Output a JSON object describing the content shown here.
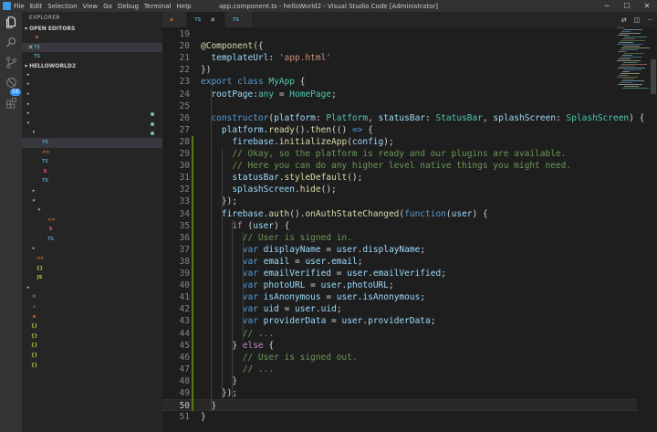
{
  "titlebar": {
    "menu": [
      "File",
      "Edit",
      "Selection",
      "View",
      "Go",
      "Debug",
      "Terminal",
      "Help"
    ],
    "title": "app.component.ts - helloWorld2 - Visual Studio Code [Administrator]"
  },
  "activity": {
    "badge": "58"
  },
  "sidebar": {
    "explorer_title": "EXPLORER",
    "open_editors_title": "OPEN EDITORS",
    "open_editors": [
      {
        "name": "config.xml",
        "dir": "",
        "status": "U",
        "kind": "xml"
      },
      {
        "name": "app.component.ts",
        "dir": "src\\app",
        "status": "M",
        "kind": "ts"
      },
      {
        "name": "app.module.ts",
        "dir": "src\\app",
        "status": "",
        "kind": "ts"
      }
    ],
    "project_title": "HELLOWORLD2",
    "tree": [
      {
        "name": ".sourcemaps",
        "depth": 1,
        "arrow": "▸",
        "kind": "folder",
        "status": "",
        "dot": false
      },
      {
        "name": "node_modules",
        "depth": 1,
        "arrow": "▸",
        "kind": "folder",
        "status": "",
        "dot": false
      },
      {
        "name": "platforms",
        "depth": 1,
        "arrow": "▸",
        "kind": "folder",
        "status": "",
        "dot": false
      },
      {
        "name": "plugins",
        "depth": 1,
        "arrow": "▸",
        "kind": "folder",
        "status": "",
        "dot": false
      },
      {
        "name": "resources",
        "depth": 1,
        "arrow": "▸",
        "kind": "folder-new",
        "status": "",
        "dot": true
      },
      {
        "name": "src",
        "depth": 1,
        "arrow": "▾",
        "kind": "folder",
        "status": "",
        "dot": true
      },
      {
        "name": "app",
        "depth": 2,
        "arrow": "▾",
        "kind": "folder",
        "status": "",
        "dot": true
      },
      {
        "name": "app.component.ts",
        "depth": 3,
        "arrow": "",
        "kind": "ts",
        "status": "M",
        "dot": false
      },
      {
        "name": "app.html",
        "depth": 3,
        "arrow": "",
        "kind": "html",
        "status": "",
        "dot": false
      },
      {
        "name": "app.module.ts",
        "depth": 3,
        "arrow": "",
        "kind": "ts",
        "status": "",
        "dot": false
      },
      {
        "name": "app.scss",
        "depth": 3,
        "arrow": "",
        "kind": "scss",
        "status": "",
        "dot": false
      },
      {
        "name": "main.ts",
        "depth": 3,
        "arrow": "",
        "kind": "ts",
        "status": "",
        "dot": false
      },
      {
        "name": "assets",
        "depth": 2,
        "arrow": "▸",
        "kind": "folder",
        "status": "",
        "dot": false
      },
      {
        "name": "pages",
        "depth": 2,
        "arrow": "▾",
        "kind": "folder",
        "status": "",
        "dot": false
      },
      {
        "name": "home",
        "depth": 3,
        "arrow": "▾",
        "kind": "folder",
        "status": "",
        "dot": false
      },
      {
        "name": "home.html",
        "depth": 4,
        "arrow": "",
        "kind": "html",
        "status": "",
        "dot": false
      },
      {
        "name": "home.scss",
        "depth": 4,
        "arrow": "",
        "kind": "scss",
        "status": "",
        "dot": false
      },
      {
        "name": "home.ts",
        "depth": 4,
        "arrow": "",
        "kind": "ts",
        "status": "",
        "dot": false
      },
      {
        "name": "theme",
        "depth": 2,
        "arrow": "▸",
        "kind": "folder",
        "status": "",
        "dot": false
      },
      {
        "name": "index.html",
        "depth": 2,
        "arrow": "",
        "kind": "html",
        "status": "",
        "dot": false
      },
      {
        "name": "manifest.json",
        "depth": 2,
        "arrow": "",
        "kind": "json",
        "status": "",
        "dot": false
      },
      {
        "name": "service-worker.js",
        "depth": 2,
        "arrow": "",
        "kind": "js",
        "status": "",
        "dot": false
      },
      {
        "name": "www",
        "depth": 1,
        "arrow": "▸",
        "kind": "folder",
        "status": "",
        "dot": false
      },
      {
        "name": ".editorconfig",
        "depth": 1,
        "arrow": "",
        "kind": "cfg",
        "status": "",
        "dot": false
      },
      {
        "name": ".gitignore",
        "depth": 1,
        "arrow": "",
        "kind": "git",
        "status": "",
        "dot": false
      },
      {
        "name": "config.xml",
        "depth": 1,
        "arrow": "",
        "kind": "xml",
        "status": "U",
        "dot": false
      },
      {
        "name": "ionic.config.json",
        "depth": 1,
        "arrow": "",
        "kind": "json",
        "status": "",
        "dot": false
      },
      {
        "name": "package-lock.json",
        "depth": 1,
        "arrow": "",
        "kind": "json",
        "status": "M",
        "dot": false
      },
      {
        "name": "package.json",
        "depth": 1,
        "arrow": "",
        "kind": "json",
        "status": "M",
        "dot": false
      },
      {
        "name": "tsconfig.json",
        "depth": 1,
        "arrow": "",
        "kind": "json",
        "status": "",
        "dot": false
      },
      {
        "name": "tslint.json",
        "depth": 1,
        "arrow": "",
        "kind": "json",
        "status": "",
        "dot": false
      }
    ]
  },
  "tabs": [
    {
      "label": "config.xml",
      "kind": "xml",
      "active": false,
      "italic": false
    },
    {
      "label": "app.component.ts",
      "kind": "ts",
      "active": true,
      "italic": false
    },
    {
      "label": "app.module.ts",
      "kind": "ts",
      "active": false,
      "italic": true
    }
  ],
  "editor": {
    "first_line": 19,
    "current_line": 50,
    "lines": [
      [],
      [
        [
          "t-fn",
          "@Component"
        ],
        [
          "t-p",
          "({"
        ]
      ],
      [
        [
          "t-p",
          "  "
        ],
        [
          "t-var",
          "templateUrl"
        ],
        [
          "t-p",
          ": "
        ],
        [
          "t-str",
          "'app.html'"
        ]
      ],
      [
        [
          "t-p",
          "})"
        ]
      ],
      [
        [
          "t-kw",
          "export"
        ],
        [
          "t-p",
          " "
        ],
        [
          "t-kw",
          "class"
        ],
        [
          "t-p",
          " "
        ],
        [
          "t-type",
          "MyApp"
        ],
        [
          "t-p",
          " {"
        ]
      ],
      [
        [
          "t-p",
          "  "
        ],
        [
          "t-var",
          "rootPage"
        ],
        [
          "t-p",
          ":"
        ],
        [
          "t-type",
          "any"
        ],
        [
          "t-p",
          " = "
        ],
        [
          "t-type",
          "HomePage"
        ],
        [
          "t-p",
          ";"
        ]
      ],
      [],
      [
        [
          "t-p",
          "  "
        ],
        [
          "t-kw",
          "constructor"
        ],
        [
          "t-p",
          "("
        ],
        [
          "t-var",
          "platform"
        ],
        [
          "t-p",
          ": "
        ],
        [
          "t-type",
          "Platform"
        ],
        [
          "t-p",
          ", "
        ],
        [
          "t-var",
          "statusBar"
        ],
        [
          "t-p",
          ": "
        ],
        [
          "t-type",
          "StatusBar"
        ],
        [
          "t-p",
          ", "
        ],
        [
          "t-var",
          "splashScreen"
        ],
        [
          "t-p",
          ": "
        ],
        [
          "t-type",
          "SplashScreen"
        ],
        [
          "t-p",
          ") {"
        ]
      ],
      [
        [
          "t-p",
          "    "
        ],
        [
          "t-var",
          "platform"
        ],
        [
          "t-p",
          "."
        ],
        [
          "t-fn",
          "ready"
        ],
        [
          "t-p",
          "()."
        ],
        [
          "t-fn",
          "then"
        ],
        [
          "t-p",
          "(() "
        ],
        [
          "t-kw",
          "=>"
        ],
        [
          "t-p",
          " {"
        ]
      ],
      [
        [
          "t-p",
          "      "
        ],
        [
          "t-var",
          "firebase"
        ],
        [
          "t-p",
          "."
        ],
        [
          "t-fn",
          "initializeApp"
        ],
        [
          "t-p",
          "("
        ],
        [
          "t-var",
          "config"
        ],
        [
          "t-p",
          ");"
        ]
      ],
      [
        [
          "t-p",
          "      "
        ],
        [
          "t-cm",
          "// Okay, so the platform is ready and our plugins are available."
        ]
      ],
      [
        [
          "t-p",
          "      "
        ],
        [
          "t-cm",
          "// Here you can do any higher level native things you might need."
        ]
      ],
      [
        [
          "t-p",
          "      "
        ],
        [
          "t-var",
          "statusBar"
        ],
        [
          "t-p",
          "."
        ],
        [
          "t-fn",
          "styleDefault"
        ],
        [
          "t-p",
          "();"
        ]
      ],
      [
        [
          "t-p",
          "      "
        ],
        [
          "t-var",
          "splashScreen"
        ],
        [
          "t-p",
          "."
        ],
        [
          "t-fn",
          "hide"
        ],
        [
          "t-p",
          "();"
        ]
      ],
      [
        [
          "t-p",
          "    });"
        ]
      ],
      [
        [
          "t-p",
          "    "
        ],
        [
          "t-var",
          "firebase"
        ],
        [
          "t-p",
          "."
        ],
        [
          "t-fn",
          "auth"
        ],
        [
          "t-p",
          "()."
        ],
        [
          "t-fn",
          "onAuthStateChanged"
        ],
        [
          "t-p",
          "("
        ],
        [
          "t-kw",
          "function"
        ],
        [
          "t-p",
          "("
        ],
        [
          "t-var",
          "user"
        ],
        [
          "t-p",
          ") {"
        ]
      ],
      [
        [
          "t-p",
          "      "
        ],
        [
          "t-ctl",
          "if"
        ],
        [
          "t-p",
          " ("
        ],
        [
          "t-var",
          "user"
        ],
        [
          "t-p",
          ") {"
        ]
      ],
      [
        [
          "t-p",
          "        "
        ],
        [
          "t-cm",
          "// User is signed in."
        ]
      ],
      [
        [
          "t-p",
          "        "
        ],
        [
          "t-kw",
          "var"
        ],
        [
          "t-p",
          " "
        ],
        [
          "t-var",
          "displayName"
        ],
        [
          "t-p",
          " = "
        ],
        [
          "t-var",
          "user"
        ],
        [
          "t-p",
          "."
        ],
        [
          "t-var",
          "displayName"
        ],
        [
          "t-p",
          ";"
        ]
      ],
      [
        [
          "t-p",
          "        "
        ],
        [
          "t-kw",
          "var"
        ],
        [
          "t-p",
          " "
        ],
        [
          "t-var",
          "email"
        ],
        [
          "t-p",
          " = "
        ],
        [
          "t-var",
          "user"
        ],
        [
          "t-p",
          "."
        ],
        [
          "t-var",
          "email"
        ],
        [
          "t-p",
          ";"
        ]
      ],
      [
        [
          "t-p",
          "        "
        ],
        [
          "t-kw",
          "var"
        ],
        [
          "t-p",
          " "
        ],
        [
          "t-var",
          "emailVerified"
        ],
        [
          "t-p",
          " = "
        ],
        [
          "t-var",
          "user"
        ],
        [
          "t-p",
          "."
        ],
        [
          "t-var",
          "emailVerified"
        ],
        [
          "t-p",
          ";"
        ]
      ],
      [
        [
          "t-p",
          "        "
        ],
        [
          "t-kw",
          "var"
        ],
        [
          "t-p",
          " "
        ],
        [
          "t-var",
          "photoURL"
        ],
        [
          "t-p",
          " = "
        ],
        [
          "t-var",
          "user"
        ],
        [
          "t-p",
          "."
        ],
        [
          "t-var",
          "photoURL"
        ],
        [
          "t-p",
          ";"
        ]
      ],
      [
        [
          "t-p",
          "        "
        ],
        [
          "t-kw",
          "var"
        ],
        [
          "t-p",
          " "
        ],
        [
          "t-var",
          "isAnonymous"
        ],
        [
          "t-p",
          " = "
        ],
        [
          "t-var",
          "user"
        ],
        [
          "t-p",
          "."
        ],
        [
          "t-var",
          "isAnonymous"
        ],
        [
          "t-p",
          ";"
        ]
      ],
      [
        [
          "t-p",
          "        "
        ],
        [
          "t-kw",
          "var"
        ],
        [
          "t-p",
          " "
        ],
        [
          "t-var",
          "uid"
        ],
        [
          "t-p",
          " = "
        ],
        [
          "t-var",
          "user"
        ],
        [
          "t-p",
          "."
        ],
        [
          "t-var",
          "uid"
        ],
        [
          "t-p",
          ";"
        ]
      ],
      [
        [
          "t-p",
          "        "
        ],
        [
          "t-kw",
          "var"
        ],
        [
          "t-p",
          " "
        ],
        [
          "t-var",
          "providerData"
        ],
        [
          "t-p",
          " = "
        ],
        [
          "t-var",
          "user"
        ],
        [
          "t-p",
          "."
        ],
        [
          "t-var",
          "providerData"
        ],
        [
          "t-p",
          ";"
        ]
      ],
      [
        [
          "t-p",
          "        "
        ],
        [
          "t-cm",
          "// ..."
        ]
      ],
      [
        [
          "t-p",
          "      } "
        ],
        [
          "t-ctl",
          "else"
        ],
        [
          "t-p",
          " {"
        ]
      ],
      [
        [
          "t-p",
          "        "
        ],
        [
          "t-cm",
          "// User is signed out."
        ]
      ],
      [
        [
          "t-p",
          "        "
        ],
        [
          "t-cm",
          "// ..."
        ]
      ],
      [
        [
          "t-p",
          "      }"
        ]
      ],
      [
        [
          "t-p",
          "    });"
        ]
      ],
      [
        [
          "t-p",
          "  }"
        ]
      ],
      [
        [
          "t-p",
          "}"
        ]
      ]
    ]
  },
  "colors": {
    "accent": "#3794ff",
    "git_added_bar": "#587c0c",
    "modified": "#e2c08d",
    "untracked": "#73c991"
  }
}
